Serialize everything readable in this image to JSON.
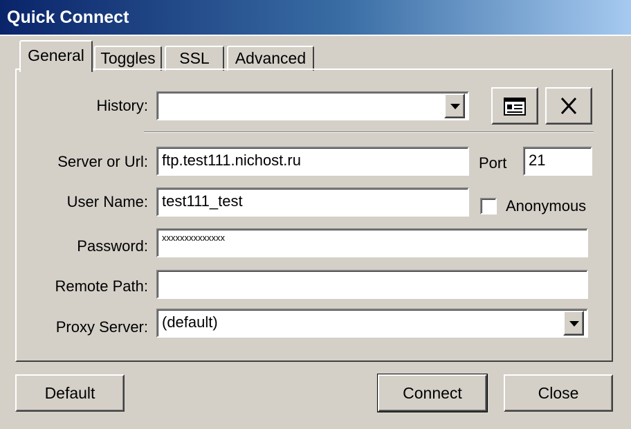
{
  "window": {
    "title": "Quick Connect"
  },
  "tabs": [
    {
      "label": "General",
      "active": true
    },
    {
      "label": "Toggles",
      "active": false
    },
    {
      "label": "SSL",
      "active": false
    },
    {
      "label": "Advanced",
      "active": false
    }
  ],
  "form": {
    "history_label": "History:",
    "history_value": "",
    "server_label": "Server or Url:",
    "server_value": "ftp.test111.nichost.ru",
    "port_label": "Port",
    "port_value": "21",
    "user_label": "User Name:",
    "user_value": "test111_test",
    "anonymous_label": "Anonymous",
    "anonymous_checked": false,
    "password_label": "Password:",
    "password_value": "xxxxxxxxxxxxxx",
    "remote_label": "Remote Path:",
    "remote_value": "",
    "proxy_label": "Proxy Server:",
    "proxy_value": "(default)"
  },
  "buttons": {
    "default": "Default",
    "connect": "Connect",
    "close": "Close"
  },
  "icons": {
    "history_manage": "address-book-icon",
    "history_delete": "close-icon"
  }
}
